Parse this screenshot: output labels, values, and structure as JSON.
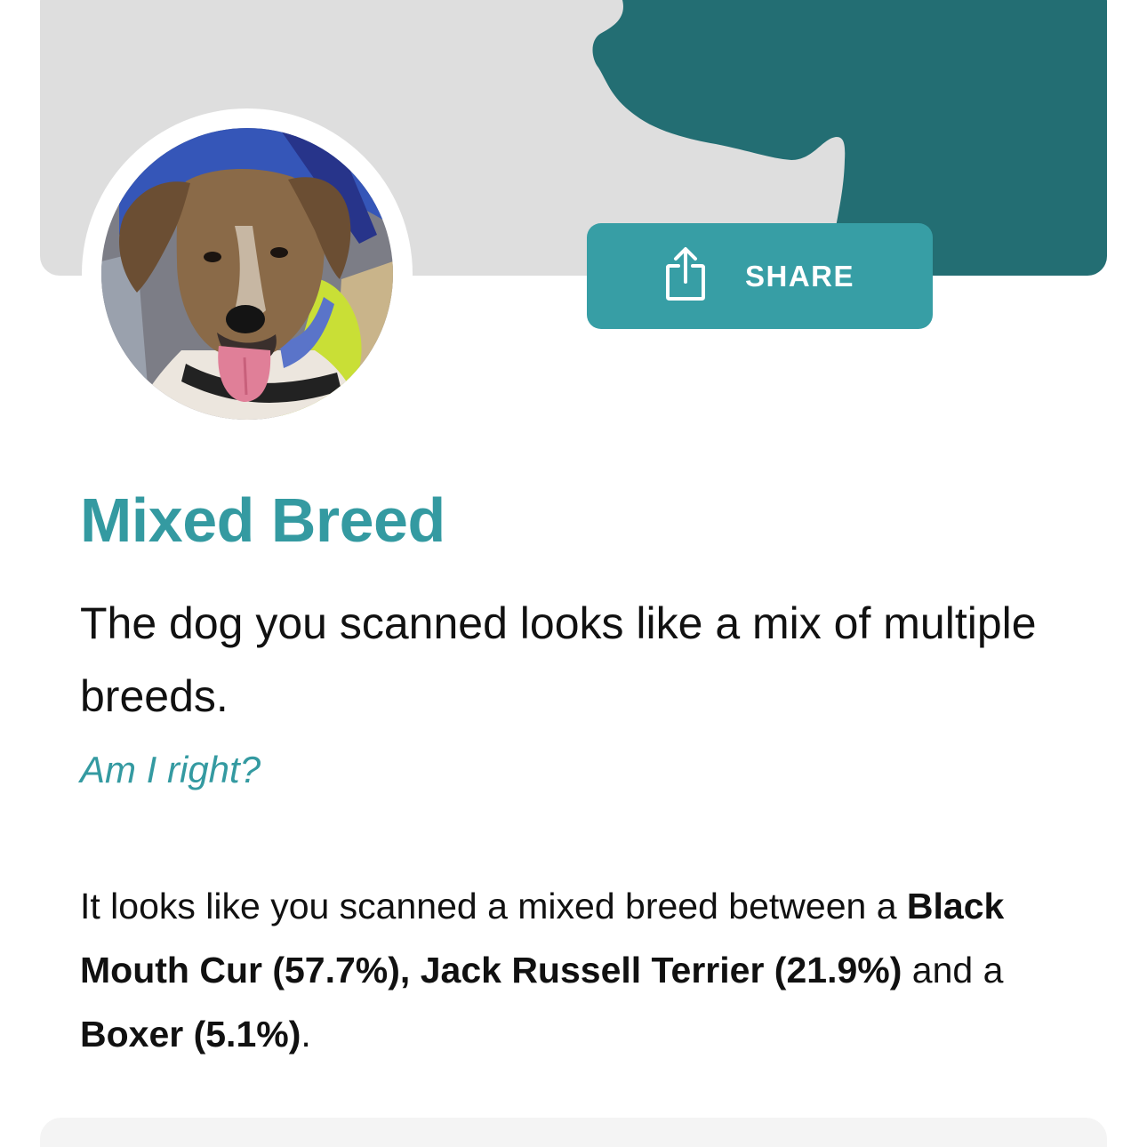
{
  "header": {
    "share_label": "SHARE",
    "colors": {
      "banner_bg": "#dedede",
      "dog_silhouette": "#236e73",
      "accent": "#379ea5"
    }
  },
  "result": {
    "title": "Mixed Breed",
    "subtitle": "The dog you scanned looks like a mix of multiple breeds.",
    "feedback_link": "Am I right?",
    "description": {
      "intro": "It looks like you scanned a mixed breed between a",
      "breed1": "Black Mouth Cur (57.7%)",
      "sep1": ",",
      "breed2": "Jack Russell Terrier (21.9%)",
      "connector": "and a",
      "breed3": "Boxer (5.1%)",
      "end": "."
    }
  },
  "icons": {
    "share": "share-icon",
    "dog_silhouette": "dog-silhouette-icon"
  }
}
